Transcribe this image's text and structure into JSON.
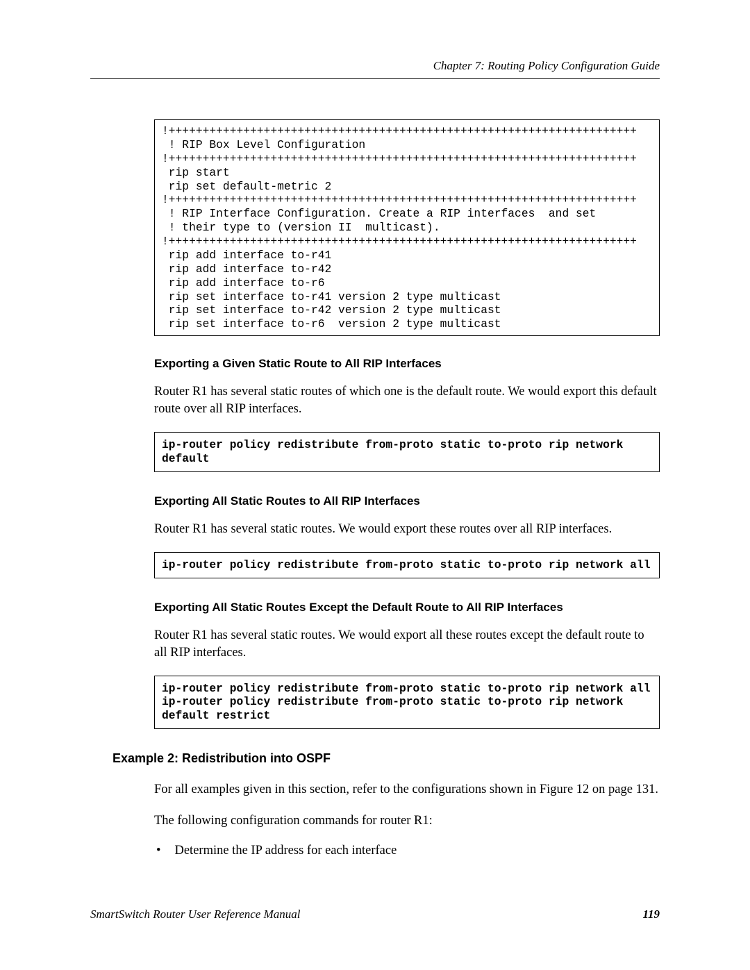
{
  "header": {
    "chapter": "Chapter 7: Routing Policy Configuration Guide"
  },
  "codeBlock1": "!+++++++++++++++++++++++++++++++++++++++++++++++++++++++++++++++++++++\n ! RIP Box Level Configuration\n!+++++++++++++++++++++++++++++++++++++++++++++++++++++++++++++++++++++\n rip start\n rip set default-metric 2\n!+++++++++++++++++++++++++++++++++++++++++++++++++++++++++++++++++++++\n ! RIP Interface Configuration. Create a RIP interfaces  and set\n ! their type to (version II  multicast).\n!+++++++++++++++++++++++++++++++++++++++++++++++++++++++++++++++++++++\n rip add interface to-r41\n rip add interface to-r42\n rip add interface to-r6\n rip set interface to-r41 version 2 type multicast\n rip set interface to-r42 version 2 type multicast\n rip set interface to-r6  version 2 type multicast",
  "section1": {
    "heading": "Exporting a Given Static Route to All RIP Interfaces",
    "paragraph": "Router R1 has several static routes of which one is the default route. We would export this default route over all RIP interfaces.",
    "code": "ip-router policy redistribute from-proto static to-proto rip network default"
  },
  "section2": {
    "heading": "Exporting All Static Routes to All RIP Interfaces",
    "paragraph": "Router R1 has several static routes. We would export these routes over all RIP interfaces.",
    "code": "ip-router policy redistribute from-proto static to-proto rip network all"
  },
  "section3": {
    "heading": "Exporting All Static Routes Except the Default Route to All RIP Interfaces",
    "paragraph": "Router R1 has several static routes. We would export all these routes except the default route to all RIP interfaces.",
    "code": "ip-router policy redistribute from-proto static to-proto rip network all\nip-router policy redistribute from-proto static to-proto rip network default restrict"
  },
  "example2": {
    "heading": "Example 2: Redistribution into OSPF",
    "paragraph1": "For all examples given in this section, refer to the configurations shown in Figure 12 on page 131.",
    "paragraph2": "The following configuration commands for router R1:",
    "bullet1": "Determine the IP address for each interface"
  },
  "footer": {
    "left": "SmartSwitch Router User Reference Manual",
    "right": "119"
  }
}
